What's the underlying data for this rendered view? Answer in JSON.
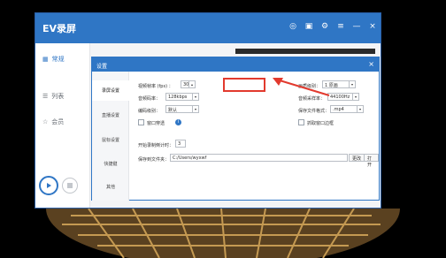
{
  "app": {
    "title": "EV录屏",
    "titlebar_icons": [
      "target-icon",
      "clipboard-icon",
      "gear-icon",
      "dropdown-menu-icon",
      "minimize-icon",
      "close-icon"
    ]
  },
  "sidebar": {
    "items": [
      {
        "label": "常规",
        "icon": "grid-icon",
        "active": true
      },
      {
        "label": "列表",
        "icon": "list-icon",
        "active": false
      },
      {
        "label": "会员",
        "icon": "star-icon",
        "active": false
      }
    ]
  },
  "settings": {
    "title": "设置",
    "close": "×",
    "tabs": [
      "录屏设置",
      "直播设置",
      "鼠标设置",
      "快捷键",
      "其他"
    ],
    "fps_label": "视频帧率 (fps) ：",
    "fps_value": "30",
    "audio_bitrate_label": "音频码率：",
    "audio_bitrate_value": "128kbps",
    "quality_label": "编码级别：",
    "quality_value": "默认",
    "window_label": "窗口穿透",
    "resolution_label": "画质级别：",
    "resolution_value": "1 原画",
    "sample_rate_label": "音频采样率：",
    "sample_rate_value": "44100Hz",
    "format_label": "保存文件格式：",
    "format_value": ".mp4",
    "capture_window_label": "抓取窗口边框",
    "countdown_label": "开始录制倒计时：",
    "countdown_value": "3",
    "save_folder_label": "保存到文件夹：",
    "save_folder_value": "C:/Users/wyxwf",
    "change_label": "更改",
    "open_label": "打开"
  }
}
